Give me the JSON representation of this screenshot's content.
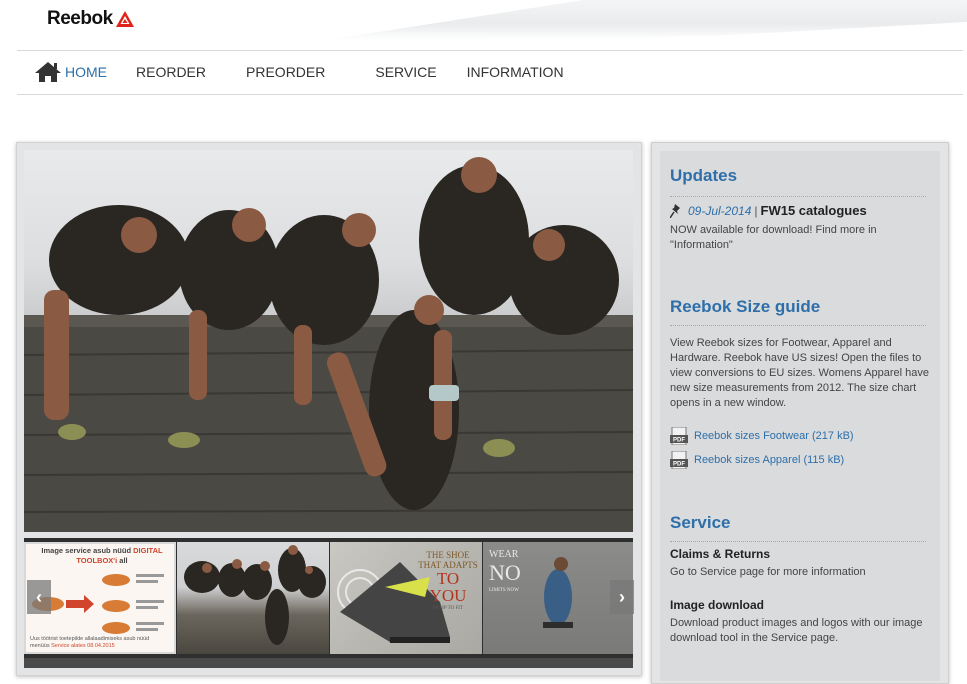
{
  "brand": {
    "name": "Reebok",
    "accent": "#e2231a"
  },
  "nav": {
    "items": [
      "HOME",
      "REORDER",
      "PREORDER",
      "SERVICE",
      "INFORMATION"
    ],
    "active_color": "#2e6fa9"
  },
  "slider": {
    "prev_label": "‹",
    "next_label": "›",
    "thumbs": [
      {
        "title_a": "Image service asub nüüd",
        "title_hl1": "DIGITAL",
        "title_hl2": "TOOLBOX'i",
        "title_b": "all",
        "footer_a": "Uus töötrist toetepilde allalaadimiseks asub nüüd",
        "footer_b": "menüüs",
        "footer_hl": "Service alates 08.04.2015"
      },
      {},
      {
        "line1": "THE SHOE",
        "line2": "THAT ADAPTS",
        "line3": "TO YOU",
        "line4": "PUMP TO FIT"
      },
      {
        "line1": "WEAR",
        "line2": "NO",
        "line3": "LIMITS NOW"
      }
    ]
  },
  "updates": {
    "title": "Updates",
    "date": "09-Jul-2014",
    "separator": "|",
    "headline": "FW15 catalogues",
    "body": "NOW available for download! Find more in \"Information\""
  },
  "size_guide": {
    "title": "Reebok Size guide",
    "body": "View Reebok sizes for Footwear, Apparel and Hardware. Reebok have US sizes! Open the files to view conversions to EU sizes. Womens Apparel have new size measurements from 2012. The size chart opens in a new window.",
    "links": [
      "Reebok sizes Footwear (217 kB)",
      "Reebok sizes Apparel (115 kB)"
    ],
    "pdf_label": "PDF"
  },
  "service": {
    "title": "Service",
    "claims_title": "Claims & Returns",
    "claims_body": "Go to Service page for more information",
    "image_title": "Image download",
    "image_body": "Download product images and logos with our image download tool in the Service page."
  }
}
